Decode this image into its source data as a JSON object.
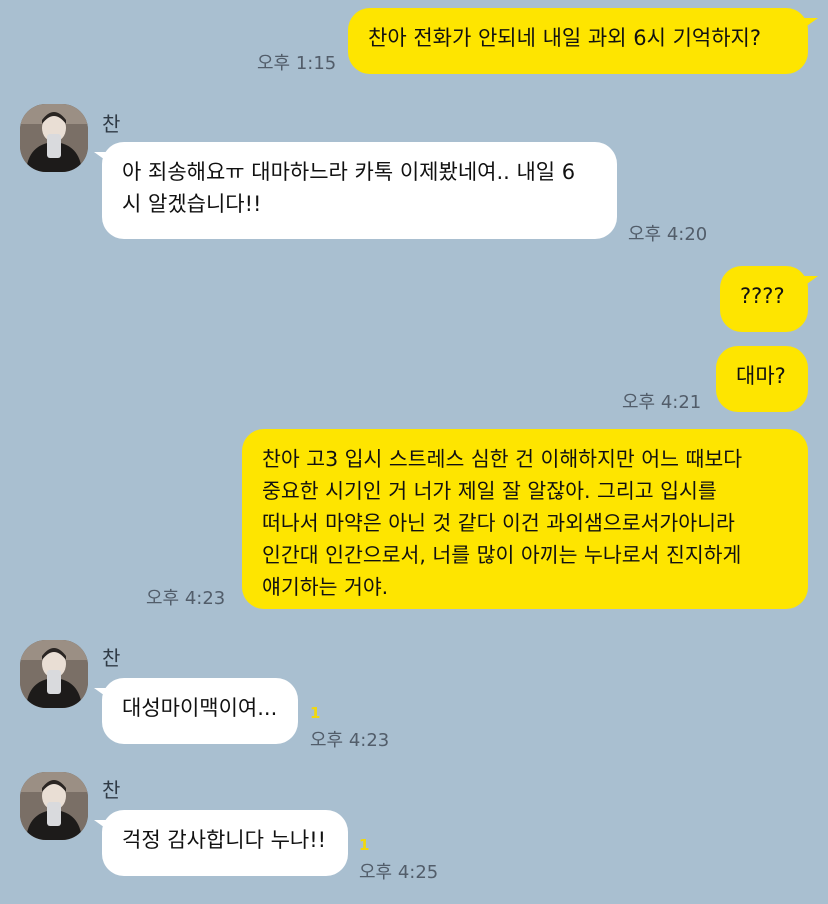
{
  "messages": [
    {
      "text": "찬아 전화가 안되네 내일 과외 6시 기억하지?",
      "time": "오후 1:15"
    },
    {
      "sender": "찬",
      "text": "아 죄송해요ㅠ 대마하느라 카톡 이제봤네여.. 내일 6\n시 알겠습니다!!",
      "time": "오후 4:20"
    },
    {
      "text": "????"
    },
    {
      "text": "대마?",
      "time": "오후 4:21"
    },
    {
      "text": "찬아 고3 입시 스트레스 심한 건 이해하지만 어느 때보다\n중요한 시기인 거 너가 제일 잘 알잖아. 그리고 입시를\n떠나서 마약은 아닌 것 같다 이건 과외샘으로서가아니라\n인간대 인간으로서, 너를 많이 아끼는 누나로서 진지하게\n얘기하는 거야.",
      "time": "오후 4:23"
    },
    {
      "sender": "찬",
      "text": "대성마이맥이여...",
      "time": "오후 4:23",
      "unread": "1"
    },
    {
      "sender": "찬",
      "text": "걱정 감사합니다 누나!!",
      "time": "오후 4:25",
      "unread": "1"
    }
  ],
  "colors": {
    "background": "#a9bfd0",
    "my_bubble": "#fee500",
    "their_bubble": "#ffffff",
    "unread_count": "#f2d80c"
  }
}
